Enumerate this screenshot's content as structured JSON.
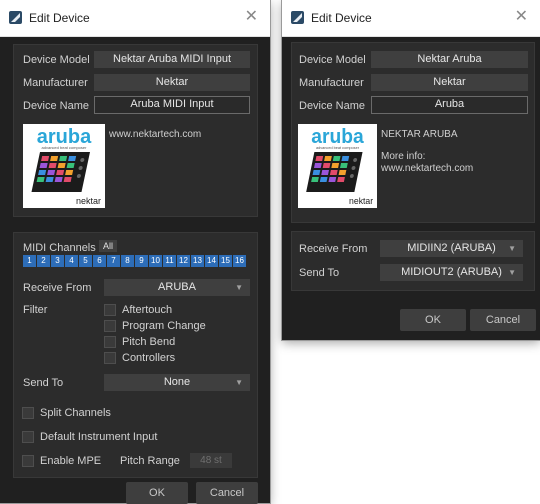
{
  "left": {
    "title": "Edit Device",
    "device_model_label": "Device Model",
    "device_model_value": "Nektar Aruba MIDI Input",
    "manufacturer_label": "Manufacturer",
    "manufacturer_value": "Nektar",
    "device_name_label": "Device Name",
    "device_name_value": "Aruba MIDI Input",
    "info_text": "www.nektartech.com",
    "midi_channels_label": "MIDI Channels",
    "all_label": "All",
    "channels": [
      "1",
      "2",
      "3",
      "4",
      "5",
      "6",
      "7",
      "8",
      "9",
      "10",
      "11",
      "12",
      "13",
      "14",
      "15",
      "16"
    ],
    "receive_from_label": "Receive From",
    "receive_from_value": "ARUBA",
    "filter_label": "Filter",
    "filters": [
      "Aftertouch",
      "Program Change",
      "Pitch Bend",
      "Controllers"
    ],
    "send_to_label": "Send To",
    "send_to_value": "None",
    "split_channels_label": "Split Channels",
    "default_instrument_label": "Default Instrument Input",
    "enable_mpe_label": "Enable MPE",
    "pitch_range_label": "Pitch Range",
    "pitch_range_value": "48 st",
    "ok_label": "OK",
    "cancel_label": "Cancel"
  },
  "right": {
    "title": "Edit Device",
    "device_model_label": "Device Model",
    "device_model_value": "Nektar Aruba",
    "manufacturer_label": "Manufacturer",
    "manufacturer_value": "Nektar",
    "device_name_label": "Device Name",
    "device_name_value": "Aruba",
    "info_title": "NEKTAR ARUBA",
    "info_more": "More info:",
    "info_url": "www.nektartech.com",
    "receive_from_label": "Receive From",
    "receive_from_value": "MIDIIN2 (ARUBA)",
    "send_to_label": "Send To",
    "send_to_value": "MIDIOUT2 (ARUBA)",
    "ok_label": "OK",
    "cancel_label": "Cancel"
  },
  "logo": {
    "brand": "aruba",
    "tagline": "advanced beat composer",
    "maker": "nektar"
  },
  "colors": {
    "dialog_bg": "#202020",
    "panel_bg": "#2c2c2c",
    "channel_blue": "#2d6db8",
    "logo_cyan": "#2aa6d8"
  }
}
